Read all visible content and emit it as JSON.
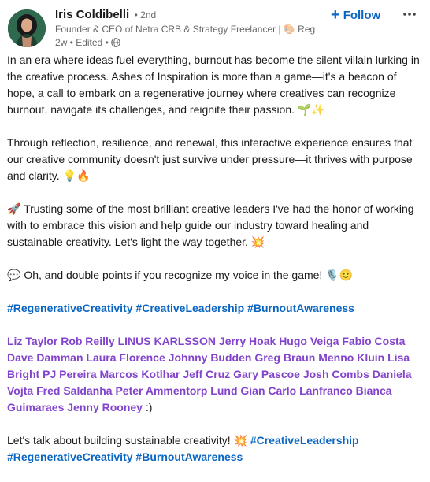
{
  "author": {
    "name": "Iris Coldibelli",
    "degree": "• 2nd",
    "headline": "Founder & CEO of Netra CRB & Strategy Freelancer | 🎨 Regen...",
    "meta_time": "2w • Edited •"
  },
  "actions": {
    "follow_label": "Follow",
    "more_icon": "ellipsis-icon"
  },
  "paragraphs": {
    "p1": "In an era where ideas fuel everything, burnout has become the silent villain lurking in the creative process. Ashes of Inspiration is more than a game—it's a beacon of hope, a call to embark on a regenerative journey where creatives can recognize burnout, navigate its challenges, and reignite their passion. 🌱✨",
    "p2": "Through reflection, resilience, and renewal, this interactive experience ensures that our creative community doesn't just survive under pressure—it thrives with purpose and clarity. 💡🔥",
    "p3": "🚀 Trusting some of the most brilliant creative leaders I've had the honor of working with to embrace this vision and help guide our industry toward healing and sustainable creativity. Let's light the way together. 💥",
    "p4": "💬 Oh, and double points if you recognize my voice in the game! 🎙️🙂"
  },
  "hashtags_1": [
    "#RegenerativeCreativity",
    "#CreativeLeadership",
    "#BurnoutAwareness"
  ],
  "mentions": [
    "Liz Taylor",
    "Rob Reilly",
    "LINUS KARLSSON",
    "Jerry Hoak",
    "Hugo Veiga",
    "Fabio Costa",
    "Dave Damman",
    "Laura Florence",
    "Johnny Budden",
    "Greg Braun",
    "Menno Kluin",
    "Lisa Bright",
    "PJ Pereira",
    "Marcos Kotlhar",
    "Jeff Cruz",
    "Gary Pascoe",
    "Josh Combs",
    "Daniela Vojta",
    "Fred Saldanha",
    "Peter Ammentorp Lund",
    "Gian Carlo Lanfranco",
    "Bianca Guimaraes",
    "Jenny Rooney"
  ],
  "mentions_suffix": " :)",
  "closing": {
    "text": "Let's talk about building sustainable creativity! 💥 ",
    "hashtags": [
      "#CreativeLeadership",
      "#RegenerativeCreativity",
      "#BurnoutAwareness"
    ]
  },
  "colors": {
    "link_blue": "#0a66c2",
    "mention_purple": "#8344cc",
    "secondary_text": "#666666"
  }
}
